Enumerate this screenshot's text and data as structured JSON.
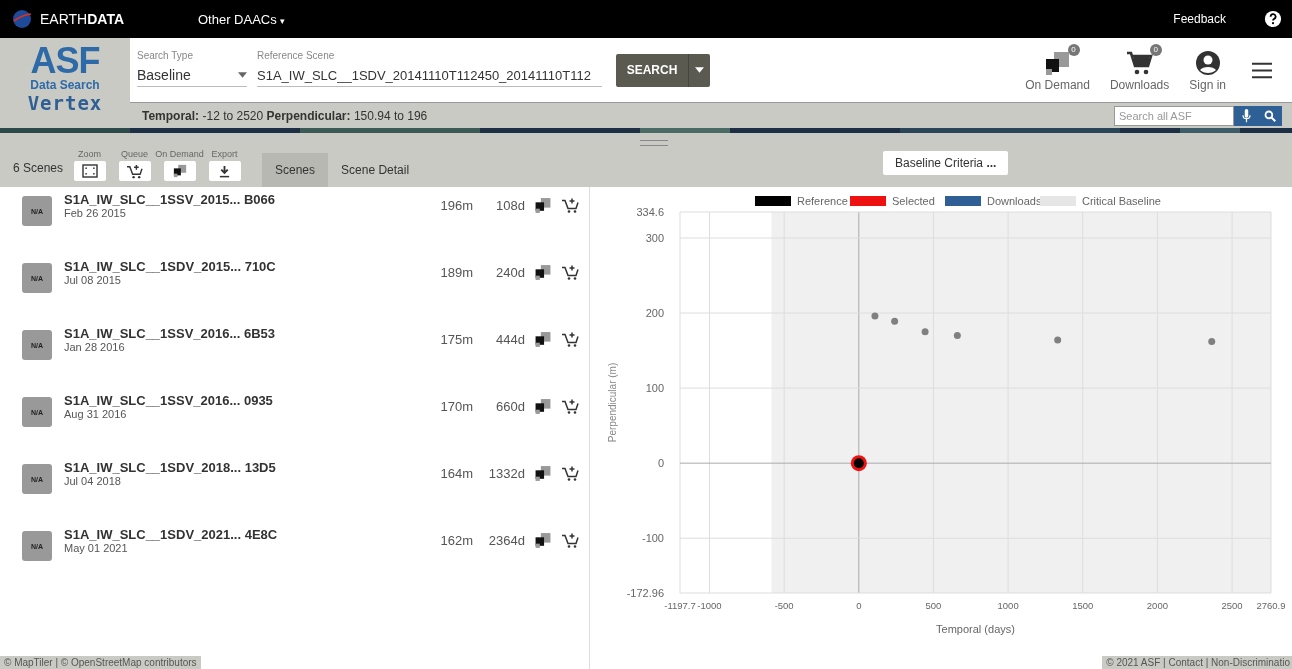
{
  "topbar": {
    "brand": "EARTH**DATA**",
    "menu": "Other DAACs",
    "menu_caret": "▾",
    "feedback": "Feedback"
  },
  "logo": {
    "mark": "ASF",
    "subtitle": "Data Search",
    "name": "Vertex"
  },
  "search": {
    "type_label": "Search Type",
    "type_value": "Baseline",
    "scene_label": "Reference Scene",
    "scene_value": "S1A_IW_SLC__1SDV_20141110T112450_20141110T112",
    "button": "SEARCH"
  },
  "actions": [
    {
      "kind": "ondemand",
      "label": "On Demand",
      "badge": "0"
    },
    {
      "kind": "downloads",
      "label": "Downloads",
      "badge": "0"
    },
    {
      "kind": "signin",
      "label": "Sign in"
    }
  ],
  "filters": "**Temporal:** -12 to 2520 **Perpendicular:** 150.94 to 196",
  "site_search": {
    "placeholder": "Search all ASF"
  },
  "toolbar": {
    "count": "6 Scenes",
    "tools": [
      {
        "kind": "zoom",
        "label": "Zoom"
      },
      {
        "kind": "queue",
        "label": "Queue"
      },
      {
        "kind": "ondemand",
        "label": "On Demand"
      },
      {
        "kind": "export",
        "label": "Export"
      }
    ],
    "tabs": [
      {
        "label": "Scenes",
        "selected": true
      },
      {
        "label": "Scene Detail",
        "selected": false
      }
    ],
    "criteria": "Baseline Criteria",
    "criteria_more": "..."
  },
  "scenes": [
    {
      "thumb": "N/A",
      "name": "S1A_IW_SLC__1SSV_2015... B066",
      "date": "Feb 26 2015",
      "perpendicular": "196m",
      "temporal": "108d"
    },
    {
      "thumb": "N/A",
      "name": "S1A_IW_SLC__1SDV_2015... 710C",
      "date": "Jul 08 2015",
      "perpendicular": "189m",
      "temporal": "240d"
    },
    {
      "thumb": "N/A",
      "name": "S1A_IW_SLC__1SSV_2016... 6B53",
      "date": "Jan 28 2016",
      "perpendicular": "175m",
      "temporal": "444d"
    },
    {
      "thumb": "N/A",
      "name": "S1A_IW_SLC__1SSV_2016... 0935",
      "date": "Aug 31 2016",
      "perpendicular": "170m",
      "temporal": "660d"
    },
    {
      "thumb": "N/A",
      "name": "S1A_IW_SLC__1SDV_2018... 13D5",
      "date": "Jul 04 2018",
      "perpendicular": "164m",
      "temporal": "1332d"
    },
    {
      "thumb": "N/A",
      "name": "S1A_IW_SLC__1SDV_2021... 4E8C",
      "date": "May 01 2021",
      "perpendicular": "162m",
      "temporal": "2364d"
    }
  ],
  "chart": {
    "chart_data": {
      "type": "scatter",
      "xlabel": "Temporal (days)",
      "ylabel": "Perpendicular (m)",
      "x": [
        0,
        108,
        240,
        444,
        660,
        1332,
        2364
      ],
      "xlim": [
        -1197.7,
        2760.9
      ],
      "ylim": [
        -172.96,
        334.6
      ],
      "xticks": [
        -1197.7,
        -1000,
        -500,
        0,
        500,
        1000,
        1500,
        2000,
        2500,
        2760.9
      ],
      "yticks": [
        -172.96,
        -100,
        0,
        100,
        200,
        300,
        334.6
      ],
      "grid": true,
      "legend": "top",
      "bands": [
        {
          "axis": "x",
          "from": -585,
          "to": 2760.9,
          "color": "#f0f0f0"
        }
      ],
      "series": [
        {
          "name": "Reference",
          "color": "#000000",
          "values": [
            0,
            null,
            null,
            null,
            null,
            null,
            null
          ]
        },
        {
          "name": "Selected",
          "color": "#ee1111",
          "values": [
            0,
            null,
            null,
            null,
            null,
            null,
            null
          ]
        },
        {
          "color": "#808080",
          "values": [
            null,
            196,
            189,
            175,
            170,
            164,
            162
          ]
        }
      ]
    },
    "downloads_legend": {
      "label": "Downloads",
      "color": "#2f5f95"
    },
    "critical_baseline": {
      "label": "Critical Baseline",
      "color": "#e6e6e6"
    }
  },
  "attribution": "© MapTiler | © OpenStreetMap contributors",
  "footer": "© 2021 ASF  | Contact | Non-Discriminatio"
}
